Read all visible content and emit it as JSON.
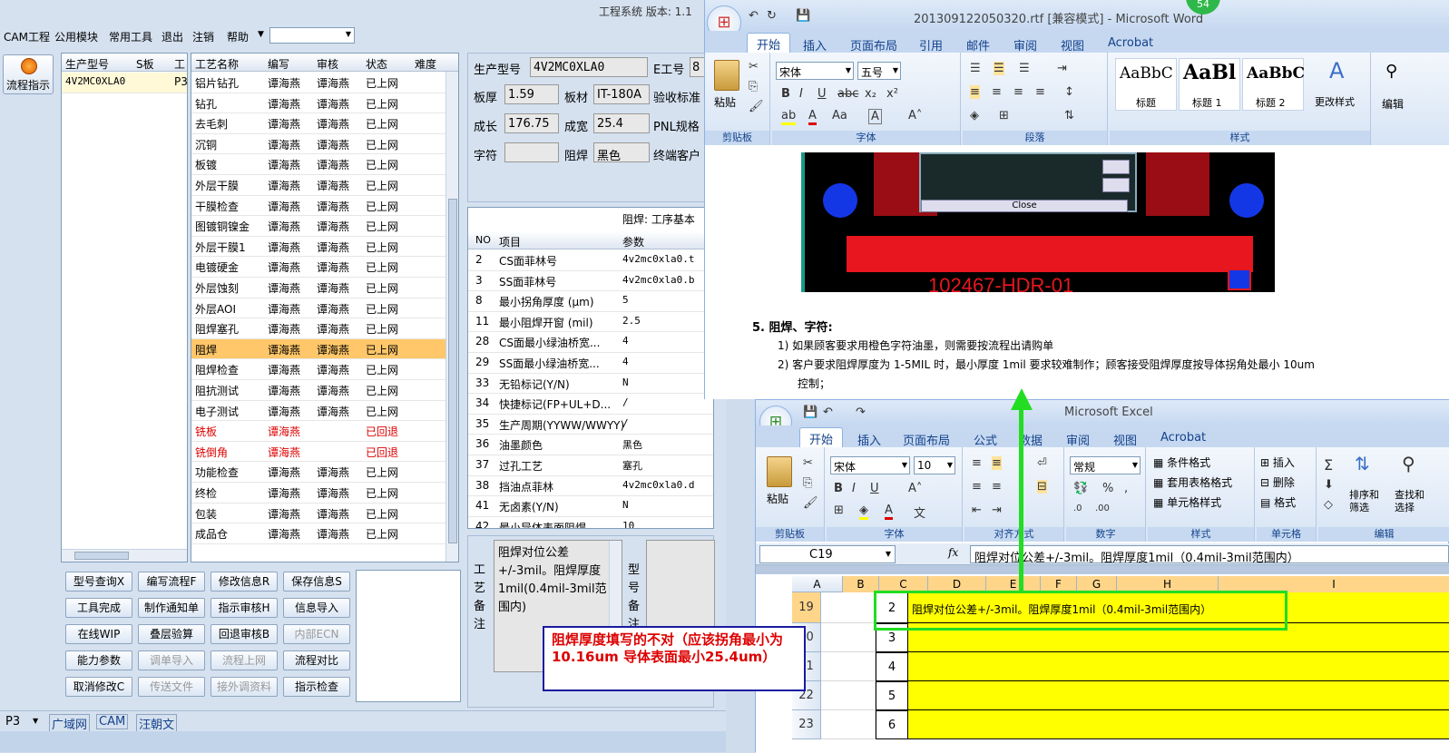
{
  "cam": {
    "menu": [
      "CAM工程",
      "公用模块",
      "常用工具",
      "退出",
      "注销",
      "帮助"
    ],
    "title": "工程系统  版本: 1.1",
    "side_label": "流程指示",
    "left_table": {
      "headers": [
        "生产型号",
        "S板",
        "工"
      ],
      "row": [
        "4V2MC0XLA0",
        "P3"
      ]
    },
    "process": {
      "headers": [
        "工艺名称",
        "编写",
        "审核",
        "状态",
        "难度"
      ],
      "rows": [
        [
          "铝片钻孔",
          "谭海燕",
          "谭海燕",
          "已上网"
        ],
        [
          "钻孔",
          "谭海燕",
          "谭海燕",
          "已上网"
        ],
        [
          "去毛刺",
          "谭海燕",
          "谭海燕",
          "已上网"
        ],
        [
          "沉铜",
          "谭海燕",
          "谭海燕",
          "已上网"
        ],
        [
          "板镀",
          "谭海燕",
          "谭海燕",
          "已上网"
        ],
        [
          "外层干膜",
          "谭海燕",
          "谭海燕",
          "已上网"
        ],
        [
          "干膜检查",
          "谭海燕",
          "谭海燕",
          "已上网"
        ],
        [
          "图镀铜镍金",
          "谭海燕",
          "谭海燕",
          "已上网"
        ],
        [
          "外层干膜1",
          "谭海燕",
          "谭海燕",
          "已上网"
        ],
        [
          "电镀硬金",
          "谭海燕",
          "谭海燕",
          "已上网"
        ],
        [
          "外层蚀刻",
          "谭海燕",
          "谭海燕",
          "已上网"
        ],
        [
          "外层AOI",
          "谭海燕",
          "谭海燕",
          "已上网"
        ],
        [
          "阻焊塞孔",
          "谭海燕",
          "谭海燕",
          "已上网"
        ],
        [
          "阻焊",
          "谭海燕",
          "谭海燕",
          "已上网"
        ],
        [
          "阻焊检查",
          "谭海燕",
          "谭海燕",
          "已上网"
        ],
        [
          "阻抗测试",
          "谭海燕",
          "谭海燕",
          "已上网"
        ],
        [
          "电子测试",
          "谭海燕",
          "谭海燕",
          "已上网"
        ],
        [
          "铣板",
          "谭海燕",
          "",
          "已回退"
        ],
        [
          "铣倒角",
          "谭海燕",
          "",
          "已回退"
        ],
        [
          "功能检查",
          "谭海燕",
          "谭海燕",
          "已上网"
        ],
        [
          "终检",
          "谭海燕",
          "谭海燕",
          "已上网"
        ],
        [
          "包装",
          "谭海燕",
          "谭海燕",
          "已上网"
        ],
        [
          "成品仓",
          "谭海燕",
          "谭海燕",
          "已上网"
        ]
      ]
    },
    "info": {
      "l_model": "生产型号",
      "v_model": "4V2MC0XLA0",
      "l_e": "E工号",
      "v_e": "8",
      "l_thick": "板厚",
      "v_thick": "1.59",
      "l_mat": "板材",
      "v_mat": "IT-180A",
      "l_accept": "验收标准",
      "l_len": "成长",
      "v_len": "176.75",
      "l_wid": "成宽",
      "v_wid": "25.4",
      "l_pnl": "PNL规格",
      "l_char": "字符",
      "v_char": "",
      "l_sm": "阻焊",
      "v_sm": "黑色",
      "l_end": "终端客户"
    },
    "param_title": "阻焊: 工序基本",
    "params": {
      "headers": [
        "NO",
        "项目",
        "参数"
      ],
      "rows": [
        [
          "2",
          "CS面菲林号",
          "4v2mc0xla0.t"
        ],
        [
          "3",
          "SS面菲林号",
          "4v2mc0xla0.b"
        ],
        [
          "8",
          "最小拐角厚度 (μm)",
          "5"
        ],
        [
          "11",
          "最小阻焊开窗 (mil)",
          "2.5"
        ],
        [
          "28",
          "CS面最小绿油桥宽...",
          "4"
        ],
        [
          "29",
          "SS面最小绿油桥宽...",
          "4"
        ],
        [
          "33",
          "无铅标记(Y/N)",
          "N"
        ],
        [
          "34",
          "快捷标记(FP+UL+D...",
          "/"
        ],
        [
          "35",
          "生产周期(YYWW/WWYY)",
          "/"
        ],
        [
          "36",
          "油墨颜色",
          "黑色"
        ],
        [
          "37",
          "过孔工艺",
          "塞孔"
        ],
        [
          "38",
          "挡油点菲林",
          "4v2mc0xla0.d"
        ],
        [
          "41",
          "无卤素(Y/N)",
          "N"
        ],
        [
          "42",
          "最小导体表面阻焊...",
          "10"
        ]
      ]
    },
    "remark_label": "工艺备注",
    "remark_text": "阻焊对位公差+/-3mil。阻焊厚度1mil(0.4mil-3mil范围内)",
    "model_remark_label": "型号备注",
    "buttons": [
      [
        "型号查询X",
        "编写流程F",
        "修改信息R",
        "保存信息S"
      ],
      [
        "工具完成",
        "制作通知单",
        "指示审核H",
        "信息导入"
      ],
      [
        "在线WIP",
        "叠层验算",
        "回退审核B",
        "内部ECN"
      ],
      [
        "能力参数",
        "调单导入",
        "流程上网",
        "流程对比"
      ],
      [
        "取消修改C",
        "传送文件",
        "接外调资料",
        "指示检查"
      ]
    ],
    "status": [
      "P3",
      "广域网",
      "CAM",
      "汪朝文"
    ]
  },
  "word": {
    "title": "201309122050320.rtf [兼容模式] - Microsoft Word",
    "tabs": [
      "开始",
      "插入",
      "页面布局",
      "引用",
      "邮件",
      "审阅",
      "视图",
      "Acrobat"
    ],
    "font": "宋体",
    "size": "五号",
    "styles": [
      "标题",
      "标题 1",
      "标题 2"
    ],
    "style_sample": [
      "AaBbC",
      "AaBl",
      "AaBbC"
    ],
    "groups": [
      "剪贴板",
      "字体",
      "段落",
      "样式"
    ],
    "change_style": "更改样式",
    "edit": "编辑",
    "paste": "粘贴",
    "close_btn": "Close",
    "pcb_label": "102467-HDR-01",
    "heading": "5.  阻焊、字符:",
    "item1": "1)  如果顾客要求用橙色字符油墨，则需要按流程出请购单",
    "item2": "2)  客户要求阻焊厚度为 1-5MIL 时，最小厚度 1mil 要求较难制作；顾客接受阻焊厚度按导体拐角处最小 10um",
    "item2b": "控制；",
    "badge": "54"
  },
  "excel": {
    "title": "Microsoft Excel",
    "tabs": [
      "开始",
      "插入",
      "页面布局",
      "公式",
      "数据",
      "审阅",
      "视图",
      "Acrobat"
    ],
    "font": "宋体",
    "size": "10",
    "fmt": "常规",
    "groups": [
      "剪贴板",
      "字体",
      "对齐方式",
      "数字",
      "样式",
      "单元格",
      "编辑"
    ],
    "style_items": [
      "条件格式",
      "套用表格格式",
      "单元格样式"
    ],
    "cell_items": [
      "插入",
      "删除",
      "格式"
    ],
    "sort": "排序和筛选",
    "find": "查找和选择",
    "paste": "粘贴",
    "namebox": "C19",
    "fx": "fx",
    "formula": "阻焊对位公差+/-3mil。阻焊厚度1mil（0.4mil-3mil范围内）",
    "cols": [
      "A",
      "B",
      "C",
      "D",
      "E",
      "F",
      "G",
      "H",
      "I"
    ],
    "row_nums": [
      "19",
      "20",
      "21",
      "22",
      "23"
    ],
    "b_vals": [
      "2",
      "3",
      "4",
      "5",
      "6"
    ],
    "c19": "阻焊对位公差+/-3mil。阻焊厚度1mil（0.4mil-3mil范围内）",
    "behind": "4V2MC0XLA0 ..."
  },
  "annotation": "阻焊厚度填写的不对（应该拐角最小为10.16um  导体表面最小25.4um）",
  "colors": {
    "yellow": "#ffff00",
    "green": "#22dd22",
    "navy": "#1a1aa0",
    "red": "#dd0000",
    "highlight": "#ffc769"
  }
}
